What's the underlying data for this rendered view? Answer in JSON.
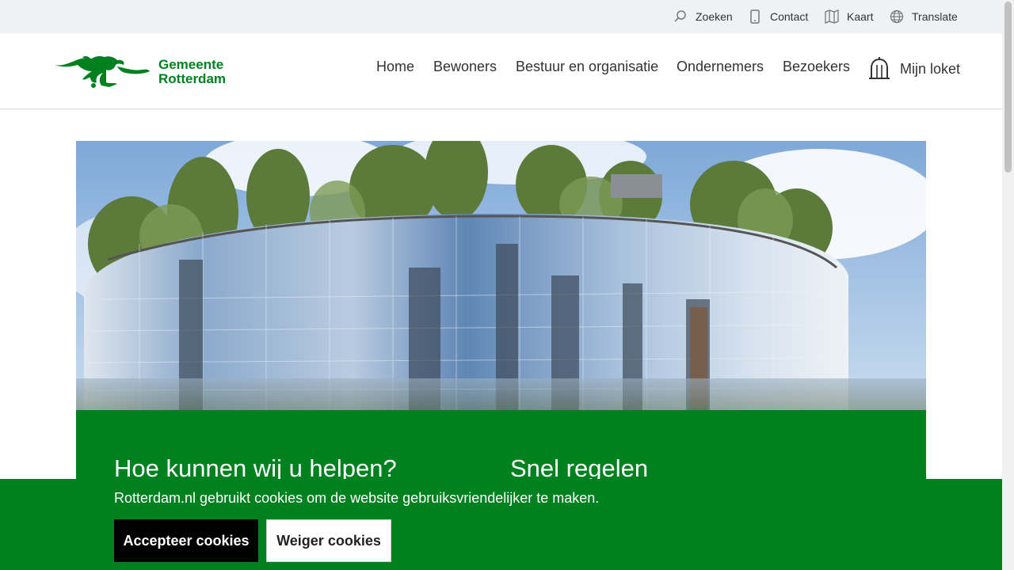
{
  "utility": {
    "search": "Zoeken",
    "contact": "Contact",
    "map": "Kaart",
    "translate": "Translate"
  },
  "logo": {
    "line1": "Gemeente",
    "line2": "Rotterdam"
  },
  "nav": {
    "home": "Home",
    "residents": "Bewoners",
    "governance": "Bestuur en organisatie",
    "entrepreneurs": "Ondernemers",
    "visitors": "Bezoekers",
    "loket": "Mijn loket"
  },
  "panel": {
    "help_heading": "Hoe kunnen wij u helpen?",
    "quick_heading": "Snel regelen"
  },
  "cookie": {
    "message": "Rotterdam.nl gebruikt cookies om de website gebruiksvriendelijker te maken.",
    "accept": "Accepteer cookies",
    "reject": "Weiger cookies"
  },
  "colors": {
    "brand_green": "#00811f",
    "utility_bg": "#eef2f5"
  }
}
